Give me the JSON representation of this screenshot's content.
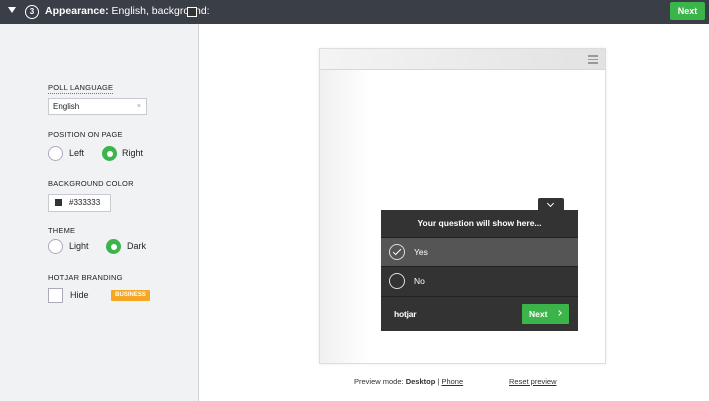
{
  "header": {
    "step": "3",
    "title_bold": "Appearance:",
    "title_rest": " English, background:",
    "swatch_color": "#333333",
    "next_label": "Next"
  },
  "settings": {
    "poll_language": {
      "label": "POLL LANGUAGE",
      "value": "English",
      "clear": "×"
    },
    "position": {
      "label": "POSITION ON PAGE",
      "options": [
        "Left",
        "Right"
      ],
      "selected": "Right"
    },
    "background_color": {
      "label": "BACKGROUND COLOR",
      "value": "#333333"
    },
    "theme": {
      "label": "THEME",
      "options": [
        "Light",
        "Dark"
      ],
      "selected": "Dark"
    },
    "branding": {
      "label": "HOTJAR BRANDING",
      "checkbox_label": "Hide",
      "checked": false,
      "badge": "BUSINESS"
    }
  },
  "preview": {
    "question": "Your question will show here...",
    "options": [
      {
        "label": "Yes",
        "selected": true
      },
      {
        "label": "No",
        "selected": false
      }
    ],
    "brand": "hotjar",
    "next_label": "Next",
    "mode_label": "Preview mode:",
    "mode_desktop": "Desktop",
    "mode_sep": "|",
    "mode_phone": "Phone",
    "reset": "Reset preview"
  },
  "colors": {
    "accent": "#3bb44a",
    "header_bg": "#3a3e47",
    "badge": "#f5a623",
    "poll_bg": "#333333"
  }
}
